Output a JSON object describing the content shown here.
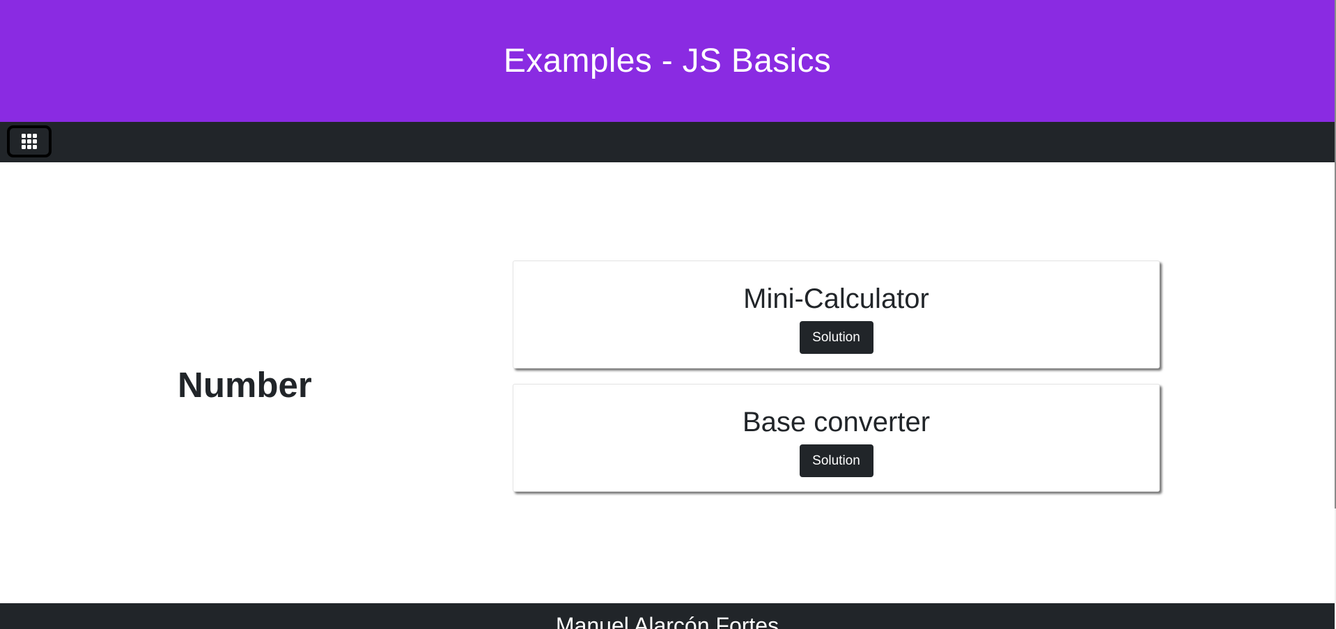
{
  "header": {
    "title": "Examples - JS Basics"
  },
  "navbar": {
    "menu_icon": "grid-icon"
  },
  "section": {
    "title": "Number",
    "cards": [
      {
        "title": "Mini-Calculator",
        "button_label": "Solution"
      },
      {
        "title": "Base converter",
        "button_label": "Solution"
      }
    ]
  },
  "footer": {
    "author": "Manuel Alarcón Fortes"
  },
  "colors": {
    "header_bg": "#8a2be2",
    "dark": "#212529"
  }
}
